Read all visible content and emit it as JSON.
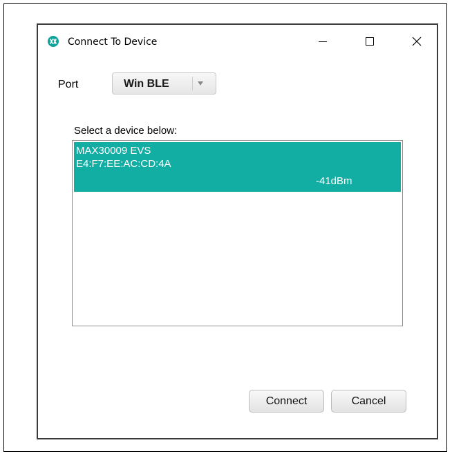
{
  "window": {
    "title": "Connect To Device",
    "accent_color": "#12ada3"
  },
  "port": {
    "label": "Port",
    "selected": "Win BLE"
  },
  "device_list": {
    "label": "Select a device below:",
    "items": [
      {
        "name": "MAX30009 EVS",
        "address": "E4:F7:EE:AC:CD:4A",
        "rssi": "-41dBm",
        "selected": true
      }
    ]
  },
  "buttons": {
    "connect": "Connect",
    "cancel": "Cancel"
  },
  "icons": {
    "app": "app-logo-icon",
    "minimize": "minimize-icon",
    "maximize": "maximize-icon",
    "close": "close-icon",
    "dropdown": "chevron-down-icon"
  }
}
